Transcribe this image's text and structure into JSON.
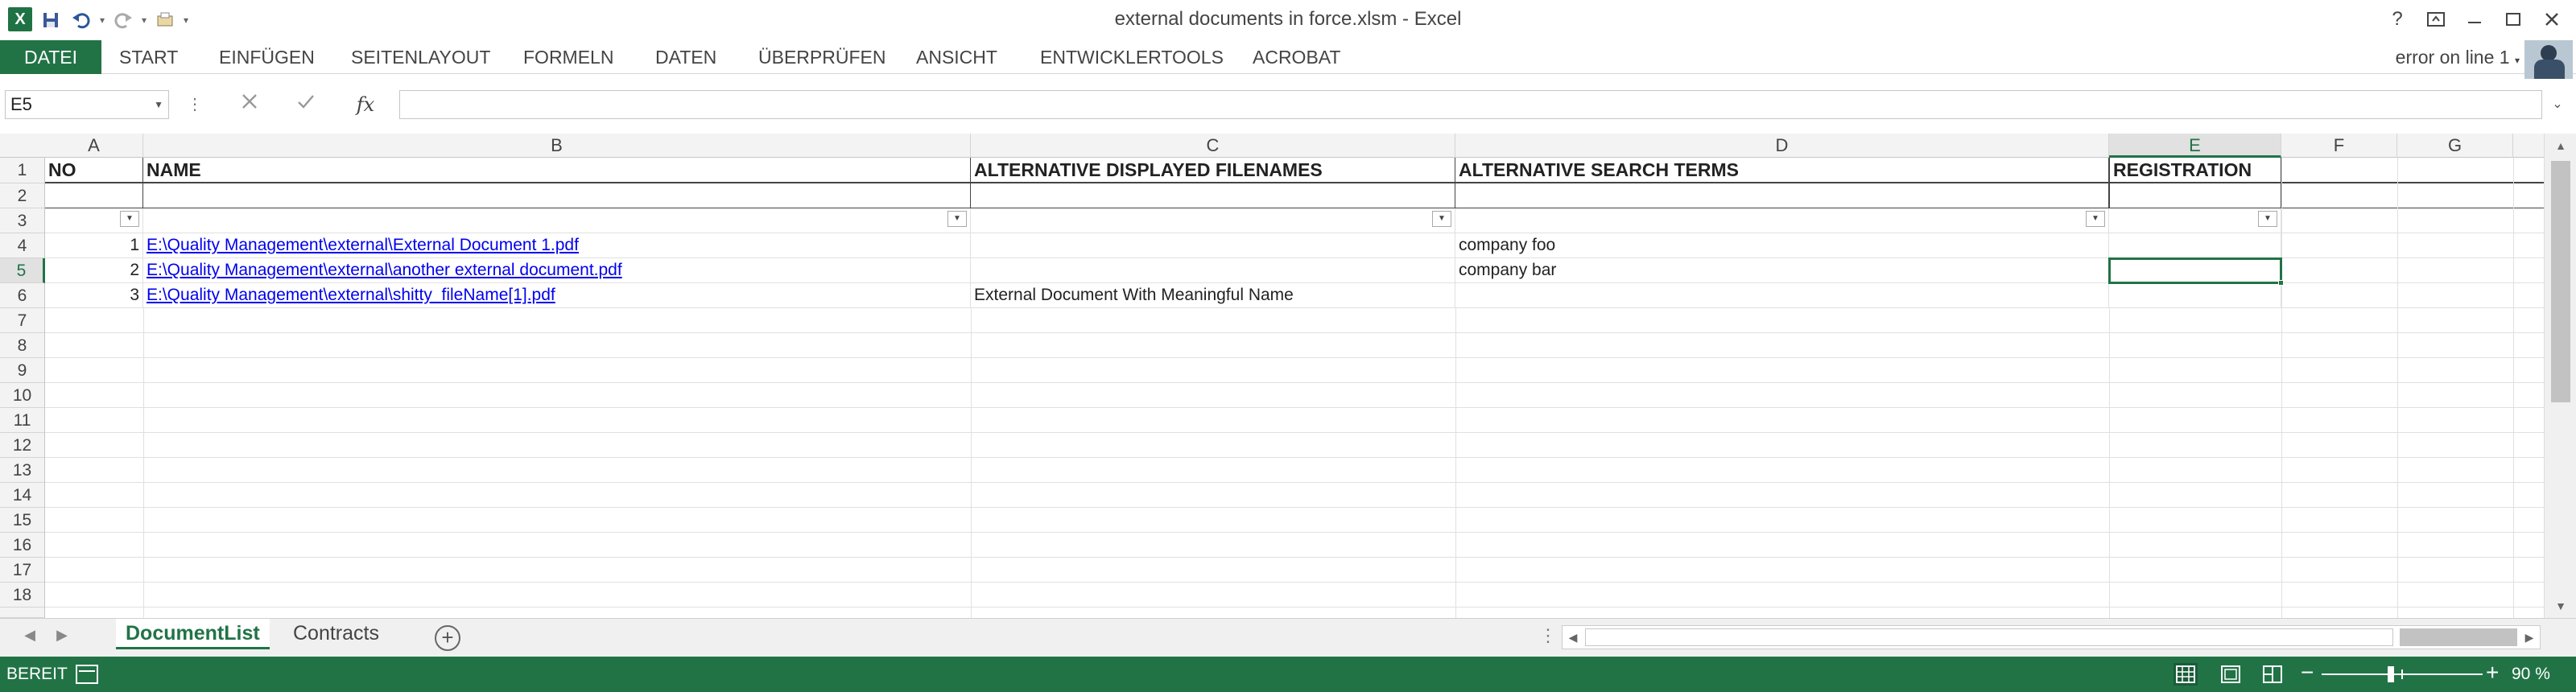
{
  "window": {
    "title": "external documents in force.xlsm - Excel",
    "app_icon_letter": "X"
  },
  "ribbon": {
    "tabs": [
      "DATEI",
      "START",
      "EINFÜGEN",
      "SEITENLAYOUT",
      "FORMELN",
      "DATEN",
      "ÜBERPRÜFEN",
      "ANSICHT",
      "ENTWICKLERTOOLS",
      "ACROBAT"
    ],
    "account": "error on line 1"
  },
  "formula_bar": {
    "name_box": "E5",
    "fx_label": "fx",
    "formula": ""
  },
  "grid": {
    "columns": [
      "A",
      "B",
      "C",
      "D",
      "E",
      "F",
      "G"
    ],
    "selected_column": "E",
    "selected_row": "5",
    "rows": [
      "1",
      "2",
      "3",
      "4",
      "5",
      "6",
      "7",
      "8",
      "9",
      "10",
      "11",
      "12",
      "13",
      "14",
      "15",
      "16",
      "17",
      "18"
    ],
    "headers": {
      "a": "NO",
      "b": "NAME",
      "c": "ALTERNATIVE DISPLAYED FILENAMES",
      "d": "ALTERNATIVE SEARCH TERMS",
      "e": "REGISTRATION"
    },
    "data": [
      {
        "no": "1",
        "name": "E:\\Quality Management\\external\\External Document 1.pdf",
        "alt_name": "",
        "search": "company foo"
      },
      {
        "no": "2",
        "name": "E:\\Quality Management\\external\\another external document.pdf",
        "alt_name": "",
        "search": "company bar"
      },
      {
        "no": "3",
        "name": "E:\\Quality Management\\external\\shitty_fileName[1].pdf",
        "alt_name": "External Document With Meaningful Name",
        "search": ""
      }
    ]
  },
  "sheets": {
    "tabs": [
      "DocumentList",
      "Contracts"
    ],
    "active": "DocumentList"
  },
  "status_bar": {
    "status": "BEREIT",
    "zoom": "90 %"
  }
}
